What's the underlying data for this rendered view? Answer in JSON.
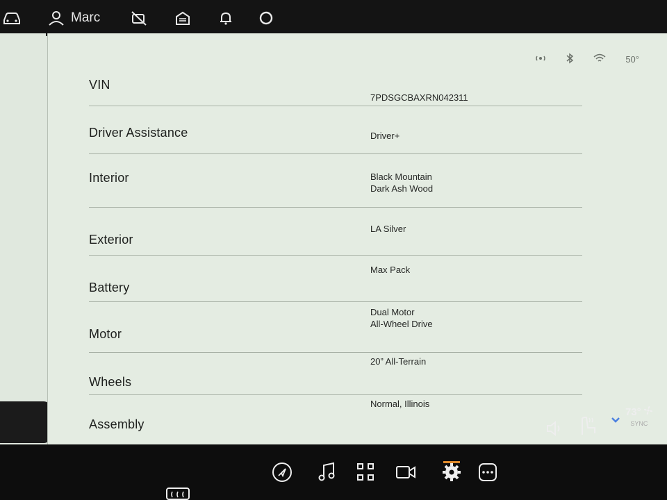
{
  "topbar": {
    "user_name": "Marc",
    "icons": [
      "car-icon",
      "user-icon",
      "camera-off-icon",
      "garage-icon",
      "bell-icon",
      "voice-assistant-icon"
    ]
  },
  "status": {
    "icons": [
      "hotspot-icon",
      "bluetooth-icon",
      "wifi-icon"
    ],
    "outside_temp": "50°"
  },
  "vehicle_info": {
    "rows": [
      {
        "label": "VIN",
        "value_line1": "7PDSGCBAXRN042311",
        "value_line2": ""
      },
      {
        "label": "Driver Assistance",
        "value_line1": "Driver+",
        "value_line2": ""
      },
      {
        "label": "Interior",
        "value_line1": "Black Mountain",
        "value_line2": "Dark Ash Wood"
      },
      {
        "label": "Exterior",
        "value_line1": "LA Silver",
        "value_line2": ""
      },
      {
        "label": "Battery",
        "value_line1": "Max Pack",
        "value_line2": ""
      },
      {
        "label": "Motor",
        "value_line1": "Dual Motor",
        "value_line2": "All-Wheel Drive"
      },
      {
        "label": "Wheels",
        "value_line1": "20” All-Terrain",
        "value_line2": ""
      },
      {
        "label": "Assembly",
        "value_line1": "Normal, Illinois",
        "value_line2": ""
      }
    ]
  },
  "dock": {
    "icons": [
      "navigation-icon",
      "music-icon",
      "apps-icon",
      "camera-icon",
      "settings-icon",
      "more-icon",
      "volume-icon",
      "seat-heat-icon",
      "chevron-down-icon",
      "fan-icon",
      "rear-defrost-icon"
    ],
    "active": "settings-icon"
  },
  "climate": {
    "temperature": "73°",
    "sync_label": "SYNC"
  },
  "colors": {
    "panel_bg": "#e4ece2",
    "divider": "#a7b0a5",
    "accent": "#e08a2a",
    "dark_bg": "#0d0d0d"
  }
}
